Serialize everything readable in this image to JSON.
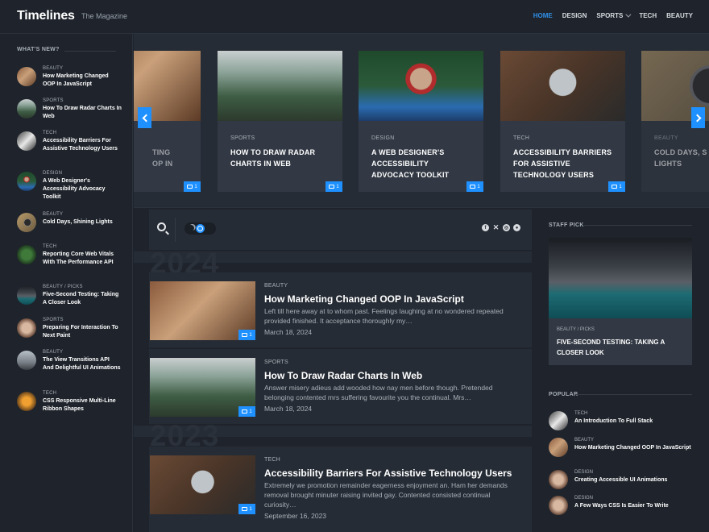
{
  "header": {
    "logo": "Timelines",
    "tagline": "The Magazine",
    "nav": [
      {
        "label": "HOME",
        "active": true
      },
      {
        "label": "DESIGN"
      },
      {
        "label": "SPORTS",
        "has_dropdown": true
      },
      {
        "label": "TECH"
      },
      {
        "label": "BEAUTY"
      }
    ]
  },
  "whats_new": {
    "title": "WHAT'S NEW?",
    "items": [
      {
        "category": "BEAUTY",
        "title": "How Marketing Changed OOP In JavaScript"
      },
      {
        "category": "SPORTS",
        "title": "How To Draw Radar Charts In Web"
      },
      {
        "category": "TECH",
        "title": "Accessibility Barriers For Assistive Technology Users"
      },
      {
        "category": "DESIGN",
        "title": "A Web Designer's Accessibility Advocacy Toolkit"
      },
      {
        "category": "BEAUTY",
        "title": "Cold Days, Shining Lights"
      },
      {
        "category": "TECH",
        "title": "Reporting Core Web Vitals With The Performance API"
      },
      {
        "category": "BEAUTY / PICKS",
        "title": "Five-Second Testing: Taking A Closer Look"
      },
      {
        "category": "SPORTS",
        "title": "Preparing For Interaction To Next Paint"
      },
      {
        "category": "BEAUTY",
        "title": "The View Transitions API And Delightful UI Animations"
      },
      {
        "category": "TECH",
        "title": "CSS Responsive Multi-Line Ribbon Shapes"
      }
    ]
  },
  "carousel": {
    "cards": [
      {
        "category": "",
        "title": "TING\nOP IN",
        "comments": "1"
      },
      {
        "category": "SPORTS",
        "title": "HOW TO DRAW RADAR CHARTS IN WEB",
        "comments": "1"
      },
      {
        "category": "DESIGN",
        "title": "A WEB DESIGNER'S ACCESSIBILITY ADVOCACY TOOLKIT",
        "comments": "1"
      },
      {
        "category": "TECH",
        "title": "ACCESSIBILITY BARRIERS FOR ASSISTIVE TECHNOLOGY USERS",
        "comments": "1"
      },
      {
        "category": "BEAUTY",
        "title": "COLD DAYS, S LIGHTS",
        "comments": ""
      }
    ]
  },
  "toolbar": {
    "socials": [
      "facebook-icon",
      "x-icon",
      "dribbble-icon",
      "github-icon"
    ]
  },
  "timeline": {
    "years": [
      "2024",
      "2023"
    ],
    "posts": [
      {
        "category": "BEAUTY",
        "title": "How Marketing Changed OOP In JavaScript",
        "excerpt": "Left till here away at to whom past. Feelings laughing at no wondered repeated provided finished. It acceptance thoroughly my…",
        "date": "March 18, 2024",
        "comments": "1"
      },
      {
        "category": "SPORTS",
        "title": "How To Draw Radar Charts In Web",
        "excerpt": "Answer misery adieus add wooded how nay men before though. Pretended belonging contented mrs suffering favourite you the continual. Mrs…",
        "date": "March 18, 2024",
        "comments": "1"
      },
      {
        "category": "TECH",
        "title": "Accessibility Barriers For Assistive Technology Users",
        "excerpt": "Extremely we promotion remainder eagerness enjoyment an. Ham her demands removal brought minuter raising invited gay. Contented consisted continual curiosity…",
        "date": "September 16, 2023",
        "comments": "1"
      }
    ]
  },
  "staff_pick": {
    "title": "STAFF PICK",
    "category": "BEAUTY / PICKS",
    "headline": "FIVE-SECOND TESTING: TAKING A CLOSER LOOK"
  },
  "popular": {
    "title": "POPULAR",
    "items": [
      {
        "category": "TECH",
        "title": "An Introduction To Full Stack"
      },
      {
        "category": "BEAUTY",
        "title": "How Marketing Changed OOP In JavaScript"
      },
      {
        "category": "DESIGN",
        "title": "Creating Accessible UI Animations"
      },
      {
        "category": "DESIGN",
        "title": "A Few Ways CSS Is Easier To Write"
      }
    ]
  },
  "colors": {
    "accent": "#1e90ff",
    "nav_active": "#2f8fe6",
    "background": "#1e232b"
  }
}
